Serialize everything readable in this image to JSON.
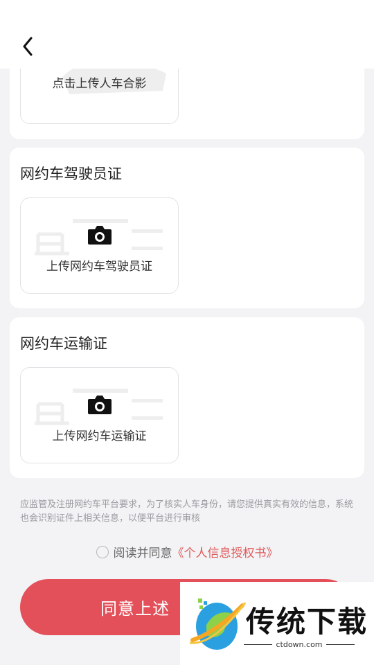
{
  "header": {
    "back_icon": "chevron-left-icon"
  },
  "photo_card": {
    "upload_label": "点击上传人车合影"
  },
  "license_card": {
    "title": "网约车驾驶员证",
    "upload_label": "上传网约车驾驶员证"
  },
  "transport_card": {
    "title": "网约车运输证",
    "upload_label": "上传网约车运输证"
  },
  "notice": "应监管及注册网约车平台要求，为了核实人车身份，请您提供真实有效的信息，系统也会识别证件上相关信息，以便平台进行审核",
  "agreement": {
    "text": "阅读并同意",
    "link": "《个人信息授权书》"
  },
  "submit": {
    "label": "同意上述"
  },
  "watermark": {
    "brand": "传统下载",
    "url": "ctdown.com"
  },
  "colors": {
    "accent": "#e3505a",
    "link": "#e05a5a",
    "background": "#f3f3f5"
  }
}
